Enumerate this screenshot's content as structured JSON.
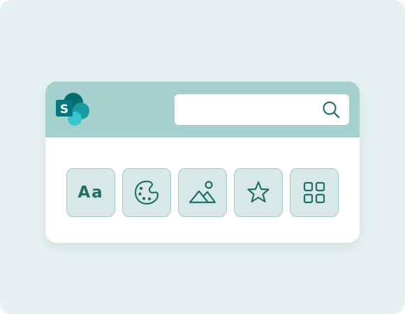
{
  "theme": {
    "background": "#e6f2f2",
    "header_color": "#a4d1cd",
    "tile_fill": "#d8e7e7",
    "tile_border": "#9fcbc6",
    "icon_color": "#1f7068"
  },
  "header": {
    "logo": {
      "icon": "sharepoint-logo-icon",
      "letter": "S"
    },
    "search": {
      "value": "",
      "placeholder": "",
      "icon": "search-icon"
    }
  },
  "tiles": [
    {
      "icon": "font-icon",
      "text": "Aa"
    },
    {
      "icon": "palette-icon"
    },
    {
      "icon": "image-icon"
    },
    {
      "icon": "star-icon"
    },
    {
      "icon": "grid-icon"
    }
  ]
}
